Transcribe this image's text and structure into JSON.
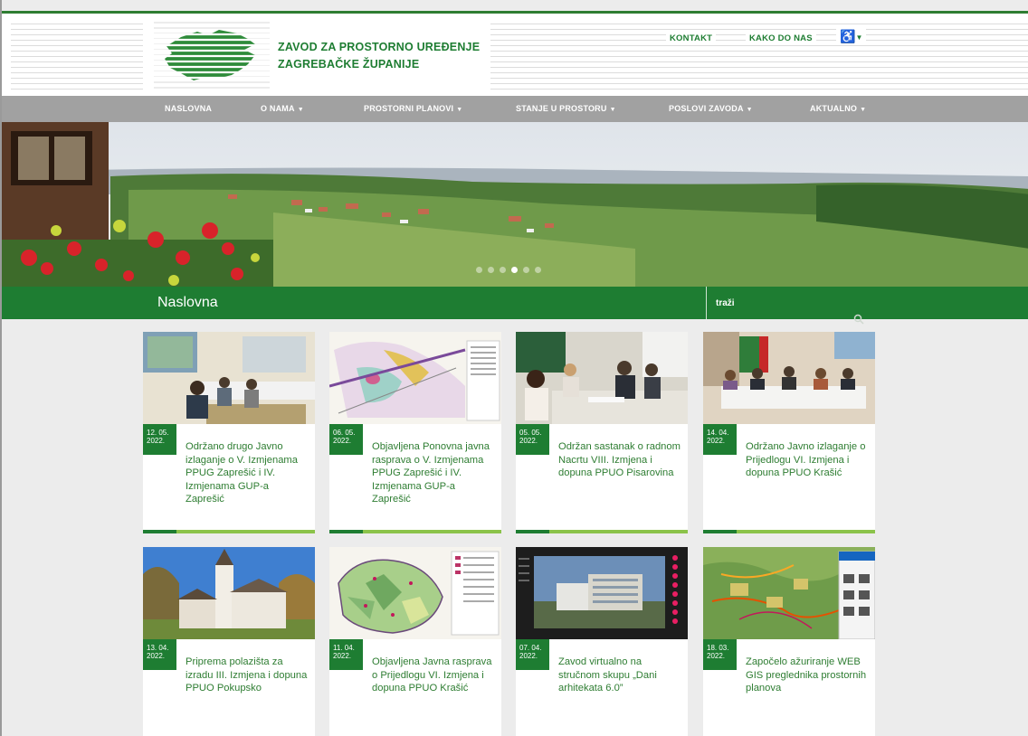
{
  "header": {
    "org_line1": "ZAVOD ZA PROSTORNO UREĐENJE",
    "org_line2": "ZAGREBAČKE ŽUPANIJE",
    "links": {
      "contact": "KONTAKT",
      "directions": "KAKO DO NAS"
    },
    "accessibility_icon": "wheelchair-icon"
  },
  "nav": {
    "items": [
      {
        "label": "NASLOVNA",
        "has_dropdown": false
      },
      {
        "label": "O NAMA",
        "has_dropdown": true
      },
      {
        "label": "PROSTORNI PLANOVI",
        "has_dropdown": true
      },
      {
        "label": "STANJE U PROSTORU",
        "has_dropdown": true
      },
      {
        "label": "POSLOVI ZAVODA",
        "has_dropdown": true
      },
      {
        "label": "AKTUALNO",
        "has_dropdown": true
      }
    ]
  },
  "hero": {
    "slide_count": 6,
    "active_slide": 4
  },
  "section": {
    "title": "Naslovna",
    "search_placeholder": "traži"
  },
  "cards": [
    {
      "date_line1": "12. 05.",
      "date_line2": "2022.",
      "title": "Održano drugo Javno izlaganje o V. Izmjenama PPUG Zaprešić i IV. Izmjenama GUP-a Zaprešić"
    },
    {
      "date_line1": "06. 05.",
      "date_line2": "2022.",
      "title": "Objavljena Ponovna javna rasprava o V. Izmjenama PPUG Zaprešić i IV. Izmjenama GUP-a Zaprešić"
    },
    {
      "date_line1": "05. 05.",
      "date_line2": "2022.",
      "title": "Održan sastanak o radnom Nacrtu VIII. Izmjena i dopuna PPUO Pisarovina"
    },
    {
      "date_line1": "14. 04.",
      "date_line2": "2022.",
      "title": "Održano Javno izlaganje o Prijedlogu VI. Izmjena i dopuna PPUO Krašić"
    },
    {
      "date_line1": "13. 04.",
      "date_line2": "2022.",
      "title": "Priprema polazišta za izradu III. Izmjena i dopuna PPUO Pokupsko"
    },
    {
      "date_line1": "11. 04.",
      "date_line2": "2022.",
      "title": "Objavljena Javna rasprava o Prijedlogu VI. Izmjena i dopuna PPUO Krašić"
    },
    {
      "date_line1": "07. 04.",
      "date_line2": "2022.",
      "title": "Zavod virtualno na stručnom skupu „Dani arhitekata 6.0”"
    },
    {
      "date_line1": "18. 03.",
      "date_line2": "2022.",
      "title": "Započelo ažuriranje WEB GIS preglednika prostornih planova"
    }
  ],
  "colors": {
    "brand_green": "#1e7d32",
    "nav_gray": "#a1a1a1",
    "accent_light_green": "#8bc34a"
  }
}
